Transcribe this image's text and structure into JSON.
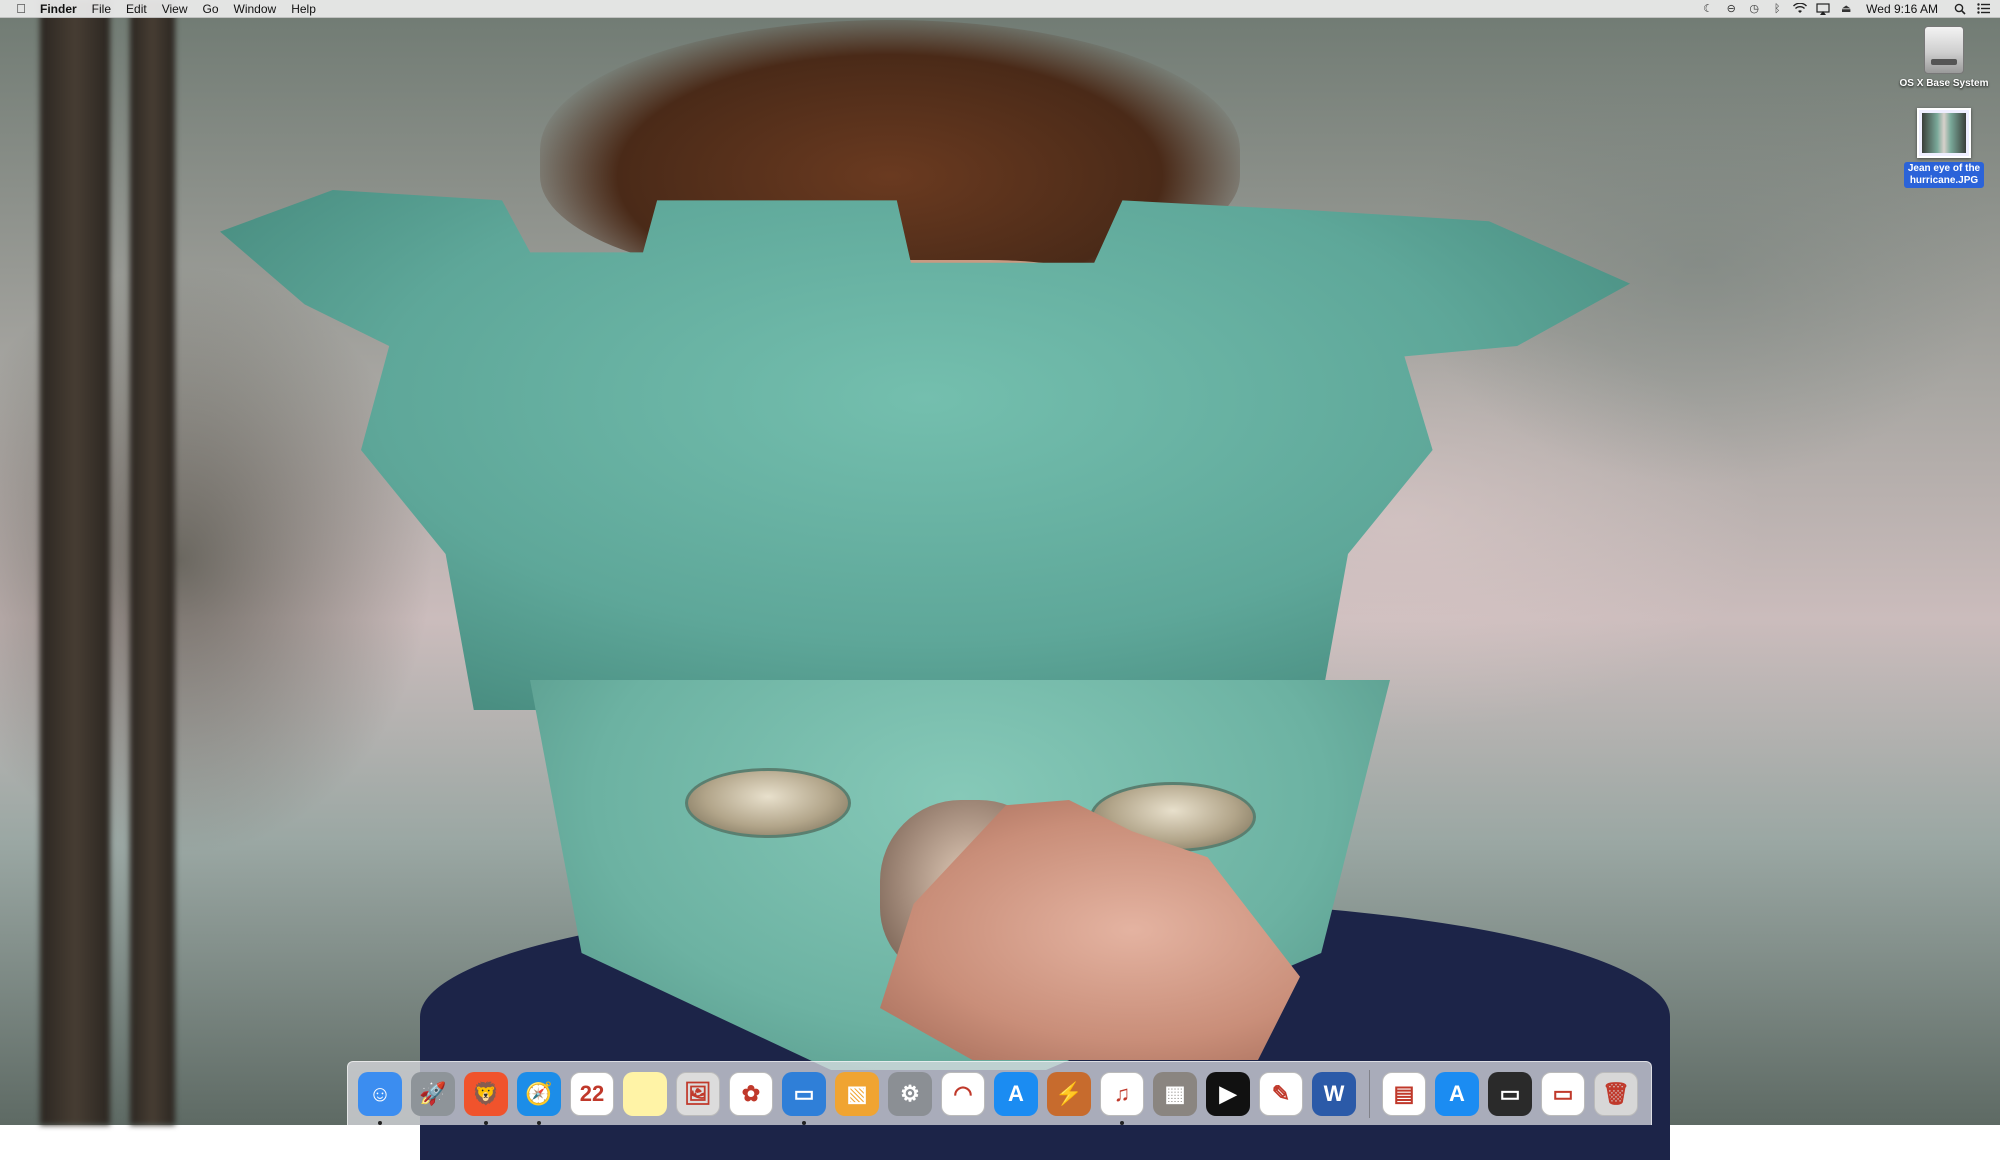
{
  "menubar": {
    "apple_icon": "apple-logo-icon",
    "app_name": "Finder",
    "menus": [
      "File",
      "Edit",
      "View",
      "Go",
      "Window",
      "Help"
    ],
    "status_icons": [
      "moon-icon",
      "do-not-disturb-icon",
      "time-machine-icon",
      "bluetooth-icon",
      "wifi-icon",
      "airplay-icon",
      "eject-icon"
    ],
    "clock": "Wed 9:16 AM",
    "search_icon": "spotlight-search-icon",
    "notifications_icon": "notification-center-icon"
  },
  "desktop": {
    "icons": [
      {
        "label": "OS X Base System",
        "type": "hard-drive-icon",
        "selected": false
      },
      {
        "label": "Jean eye of the hurricane.JPG",
        "type": "jpg-file-icon",
        "selected": true
      }
    ]
  },
  "dock": {
    "apps": [
      {
        "name": "finder-icon",
        "bg": "#3b8df0",
        "glyph": "☺",
        "running": true
      },
      {
        "name": "launchpad-icon",
        "bg": "#8e9499",
        "glyph": "🚀",
        "running": false
      },
      {
        "name": "brave-icon",
        "bg": "#f0532c",
        "glyph": "🦁",
        "running": true
      },
      {
        "name": "safari-icon",
        "bg": "#1c8de8",
        "glyph": "🧭",
        "running": true
      },
      {
        "name": "calendar-icon",
        "bg": "#ffffff",
        "glyph": "22",
        "running": false
      },
      {
        "name": "notes-icon",
        "bg": "#fff3a6",
        "glyph": "",
        "running": false
      },
      {
        "name": "preview-icon",
        "bg": "#dcdcdc",
        "glyph": "🖼",
        "running": false
      },
      {
        "name": "photos-icon",
        "bg": "#ffffff",
        "glyph": "✿",
        "running": false
      },
      {
        "name": "display-icon",
        "bg": "#2f7fd8",
        "glyph": "▭",
        "running": true
      },
      {
        "name": "image-viewer-icon",
        "bg": "#f0a431",
        "glyph": "▧",
        "running": false
      },
      {
        "name": "system-preferences-icon",
        "bg": "#8b8f94",
        "glyph": "⚙",
        "running": false
      },
      {
        "name": "wifi-diagnostics-icon",
        "bg": "#ffffff",
        "glyph": "◠",
        "running": false
      },
      {
        "name": "app-store-icon",
        "bg": "#1b8cf2",
        "glyph": "A",
        "running": false
      },
      {
        "name": "reeder-icon",
        "bg": "#c76b2d",
        "glyph": "⚡",
        "running": false
      },
      {
        "name": "itunes-icon",
        "bg": "#ffffff",
        "glyph": "♫",
        "running": true
      },
      {
        "name": "calculator-icon",
        "bg": "#8a8580",
        "glyph": "▦",
        "running": false
      },
      {
        "name": "infuse-icon",
        "bg": "#111111",
        "glyph": "▶",
        "running": false
      },
      {
        "name": "textedit-icon",
        "bg": "#ffffff",
        "glyph": "✎",
        "running": false
      },
      {
        "name": "word-icon",
        "bg": "#2b5aa8",
        "glyph": "W",
        "running": false
      }
    ],
    "stacks": [
      {
        "name": "documents-stack-icon",
        "bg": "#ffffff",
        "glyph": "▤"
      },
      {
        "name": "app-store-download-icon",
        "bg": "#1b8cf2",
        "glyph": "A"
      },
      {
        "name": "screenshot-stack-icon",
        "bg": "#2a2a2a",
        "glyph": "▭"
      },
      {
        "name": "window-stack-icon",
        "bg": "#ffffff",
        "glyph": "▭"
      },
      {
        "name": "trash-icon",
        "bg": "#d7d7d7",
        "glyph": "🗑"
      }
    ]
  }
}
